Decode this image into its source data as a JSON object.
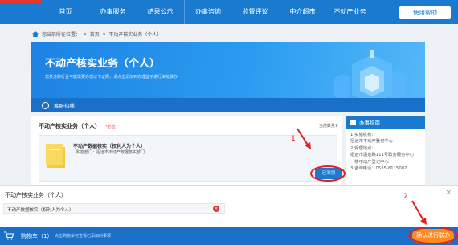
{
  "nav": {
    "items": [
      "首页",
      "办事服务",
      "结果公示",
      "办事咨询",
      "监督评议",
      "中介超市",
      "不动产业务"
    ],
    "guide_btn": "使用帮助"
  },
  "breadcrumb": {
    "prefix": "您当前所在位置：",
    "sep": "»",
    "home": "首页",
    "current": "不动产核实业务（个人）"
  },
  "banner": {
    "title": "不动产核实业务（个人）",
    "subtitle": "您关注的行业可能需要办理以下证照，请点击添加到办理篮子进行审批联办",
    "hotline": "客服热线："
  },
  "main": {
    "title": "不动产核实业务（个人）",
    "required": "*必选",
    "current_count": "当前数量1",
    "item_name": "不动产数据核实（权利人为个人）",
    "item_dept": "职能部门：招远市不动产数据核实部门",
    "added_btn": "已添加"
  },
  "side": {
    "title": "办事指南",
    "lines": [
      "1.实施机构：",
      "招远市不动产登记中心",
      "2.受理地点：",
      "招远市温泉路111号政务服务中心",
      "一楼不动产登记中心",
      "3.咨询电话：0535-8115082"
    ]
  },
  "annotations": {
    "one": "1",
    "two": "2"
  },
  "cart_panel": {
    "title": "不动产核实业务（个人）",
    "row": "不动产数据核实（权利人为个人）",
    "close": "×",
    "del": "×"
  },
  "cartbar": {
    "label": "购物车（1）",
    "hint": "点击购物车可查看已添加的事项",
    "confirm": "确认进行联办"
  },
  "colors": {
    "primary": "#1a7ad0",
    "confirm": "#ff8a1e",
    "annotation": "#e02020"
  }
}
